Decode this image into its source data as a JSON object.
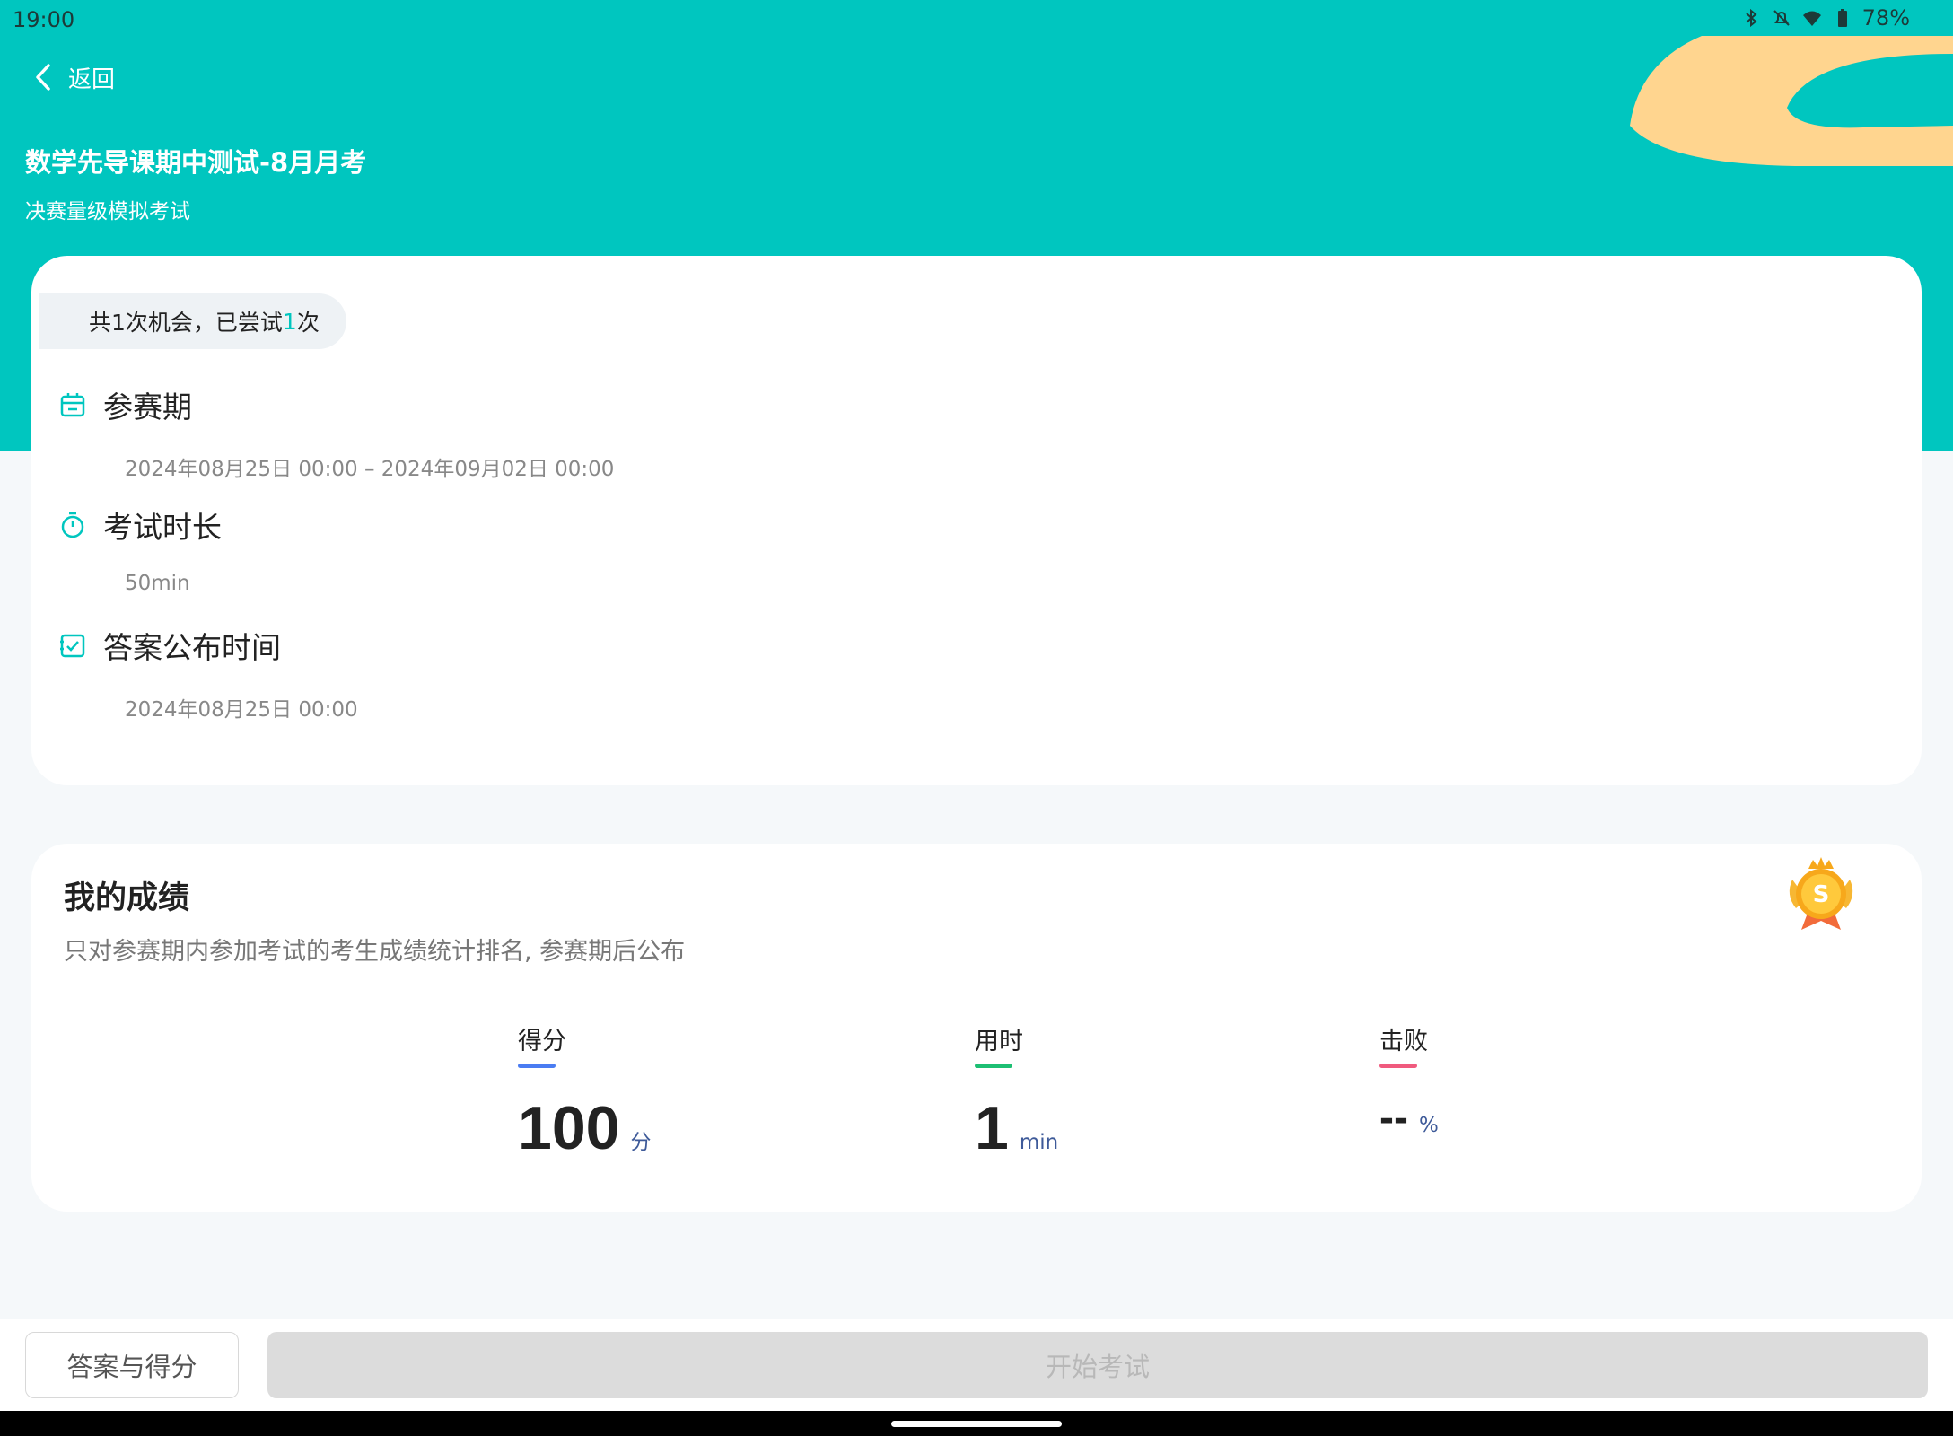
{
  "status_bar": {
    "time": "19:00",
    "battery": "78%"
  },
  "header": {
    "back_label": "返回",
    "title": "数学先导课期中测试-8月月考",
    "subtitle": "决赛量级模拟考试",
    "bg_color": "#00c6bf",
    "deco_color": "#ffd58f"
  },
  "info": {
    "attempts_prefix": "共1次机会，已尝试",
    "attempts_count": "1",
    "attempts_suffix": "次",
    "period_label": "参赛期",
    "period_value": "2024年08月25日 00:00 – 2024年09月02日 00:00",
    "duration_label": "考试时长",
    "duration_value": "50min",
    "answer_label": "答案公布时间",
    "answer_value": "2024年08月25日 00:00"
  },
  "score": {
    "title": "我的成绩",
    "description": "只对参赛期内参加考试的考生成绩统计排名, 参赛期后公布",
    "medal_letter": "S",
    "stats": [
      {
        "label": "得分",
        "value": "100",
        "unit": "分",
        "bar_color": "#4a7cf2"
      },
      {
        "label": "用时",
        "value": "1",
        "unit": "min",
        "bar_color": "#1dbf73"
      },
      {
        "label": "击败",
        "value": "--",
        "unit": "%",
        "bar_color": "#f05a7e"
      }
    ]
  },
  "actions": {
    "answers_label": "答案与得分",
    "start_label": "开始考试"
  }
}
